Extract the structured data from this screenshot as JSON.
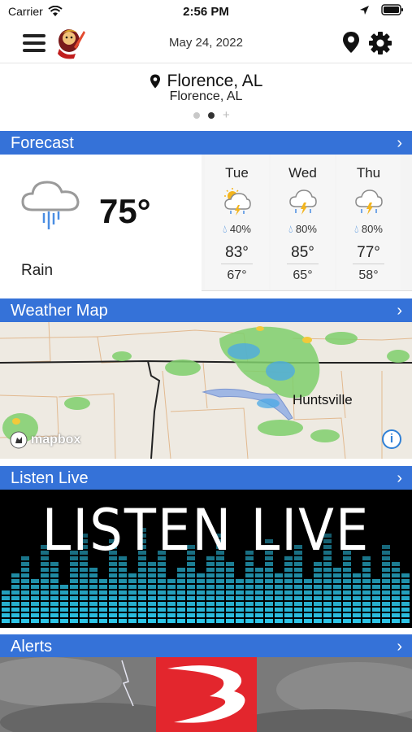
{
  "status_bar": {
    "carrier": "Carrier",
    "time": "2:56 PM"
  },
  "nav": {
    "date": "May 24, 2022"
  },
  "location": {
    "name": "Florence, AL",
    "subtitle": "Florence, AL",
    "page_count": 2,
    "active_page": 2
  },
  "sections": {
    "forecast": "Forecast",
    "weather_map": "Weather Map",
    "listen_live": "Listen Live",
    "alerts": "Alerts"
  },
  "forecast": {
    "current": {
      "temp": "75°",
      "condition": "Rain",
      "icon": "rain-cloud-icon"
    },
    "days": [
      {
        "name": "Tue",
        "icon": "partly-sunny-thunderstorm-icon",
        "precip": "40%",
        "high": "83°",
        "low": "67°"
      },
      {
        "name": "Wed",
        "icon": "thunderstorm-icon",
        "precip": "80%",
        "high": "85°",
        "low": "65°"
      },
      {
        "name": "Thu",
        "icon": "thunderstorm-icon",
        "precip": "80%",
        "high": "77°",
        "low": "58°"
      }
    ]
  },
  "map": {
    "city_label": "Huntsville",
    "attribution": "mapbox",
    "info_label": "i"
  },
  "listen_live": {
    "banner_text": "LISTEN LIVE"
  },
  "colors": {
    "section_bar": "#3572d8",
    "precip_drop": "#2f7fd8",
    "alert_logo": "#e3262d",
    "equalizer": "#2cc3e6"
  }
}
